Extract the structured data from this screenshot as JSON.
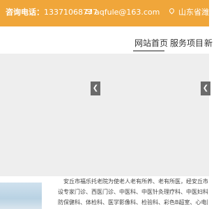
{
  "topbar": {
    "phone_label": "咨询电话：",
    "phone_number": "13371068777",
    "email_icon": "mail-icon",
    "email": "aqfule@163.com",
    "address_icon": "location-pin-icon",
    "address": "山东省潍坊市",
    "background_color": "#f0a63a"
  },
  "nav": {
    "items": [
      {
        "label": "网站首页",
        "active": true
      },
      {
        "label": "服务项目",
        "active": false
      },
      {
        "label": "新",
        "active": false
      }
    ]
  },
  "banner": {
    "prev_icon": "chevron-left-icon",
    "next_icon": "chevron-right-icon"
  },
  "intro": {
    "lines": [
      "安丘市福乐托老院为使老人老有所养、老有所医，经安丘市卫生健康局批准",
      "设专家门诊、西医门诊、中医科、中医针灸理疗科、中医妇科、中医儿科、内科",
      "防保健科、体检科、医学影像科、检验科、彩色B超室、心电图等医技科临床"
    ]
  }
}
